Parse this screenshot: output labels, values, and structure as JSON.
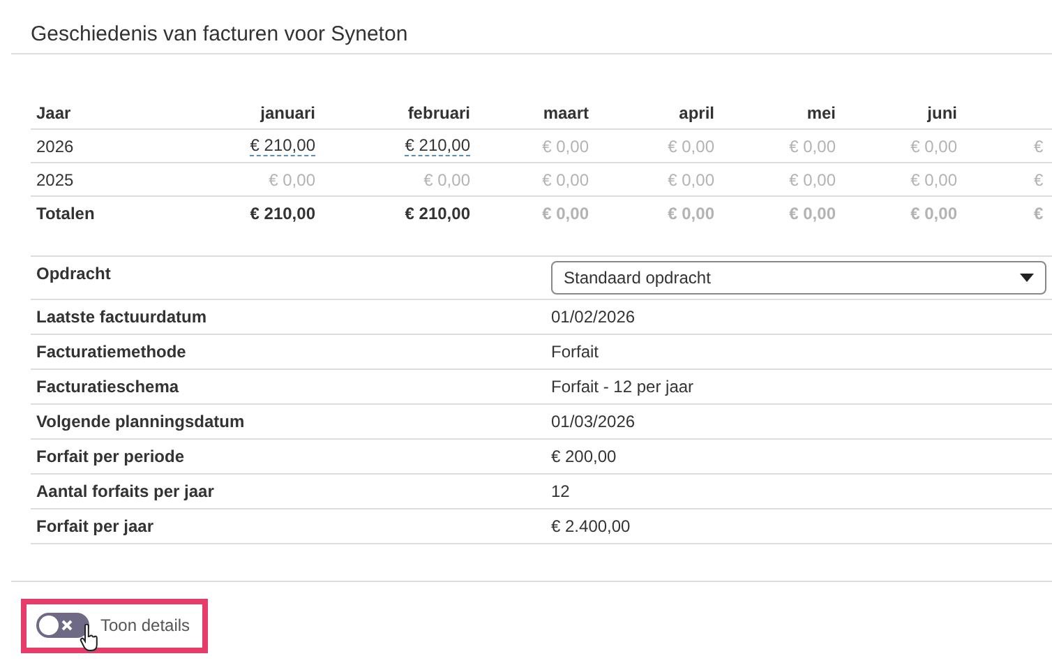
{
  "title": "Geschiedenis van facturen voor Syneton",
  "history": {
    "columns": [
      "Jaar",
      "januari",
      "februari",
      "maart",
      "april",
      "mei",
      "juni",
      ""
    ],
    "rows": [
      {
        "kind": "year",
        "cells": [
          {
            "text": "2026",
            "kind": "label"
          },
          {
            "text": "€ 210,00",
            "kind": "amount"
          },
          {
            "text": "€ 210,00",
            "kind": "amount"
          },
          {
            "text": "€ 0,00",
            "kind": "empty"
          },
          {
            "text": "€ 0,00",
            "kind": "empty"
          },
          {
            "text": "€ 0,00",
            "kind": "empty"
          },
          {
            "text": "€ 0,00",
            "kind": "empty"
          },
          {
            "text": "€",
            "kind": "empty"
          }
        ]
      },
      {
        "kind": "year",
        "cells": [
          {
            "text": "2025",
            "kind": "label"
          },
          {
            "text": "€ 0,00",
            "kind": "empty"
          },
          {
            "text": "€ 0,00",
            "kind": "empty"
          },
          {
            "text": "€ 0,00",
            "kind": "empty"
          },
          {
            "text": "€ 0,00",
            "kind": "empty"
          },
          {
            "text": "€ 0,00",
            "kind": "empty"
          },
          {
            "text": "€ 0,00",
            "kind": "empty"
          },
          {
            "text": "€",
            "kind": "empty"
          }
        ]
      },
      {
        "kind": "total",
        "cells": [
          {
            "text": "Totalen",
            "kind": "label"
          },
          {
            "text": "€ 210,00",
            "kind": "amount"
          },
          {
            "text": "€ 210,00",
            "kind": "amount"
          },
          {
            "text": "€ 0,00",
            "kind": "empty"
          },
          {
            "text": "€ 0,00",
            "kind": "empty"
          },
          {
            "text": "€ 0,00",
            "kind": "empty"
          },
          {
            "text": "€ 0,00",
            "kind": "empty"
          },
          {
            "text": "€",
            "kind": "empty"
          }
        ]
      }
    ]
  },
  "details": [
    {
      "label": "Opdracht",
      "kind": "select",
      "value": "Standaard opdracht"
    },
    {
      "label": "Laatste factuurdatum",
      "kind": "text",
      "value": "01/02/2026"
    },
    {
      "label": "Facturatiemethode",
      "kind": "text",
      "value": "Forfait"
    },
    {
      "label": "Facturatieschema",
      "kind": "text",
      "value": "Forfait - 12 per jaar"
    },
    {
      "label": "Volgende planningsdatum",
      "kind": "text",
      "value": "01/03/2026"
    },
    {
      "label": "Forfait per periode",
      "kind": "text",
      "value": "€ 200,00"
    },
    {
      "label": "Aantal forfaits per jaar",
      "kind": "text",
      "value": "12"
    },
    {
      "label": "Forfait per jaar",
      "kind": "text",
      "value": "€ 2.400,00"
    }
  ],
  "toggle": {
    "label": "Toon details",
    "on": false,
    "highlighted": true
  }
}
